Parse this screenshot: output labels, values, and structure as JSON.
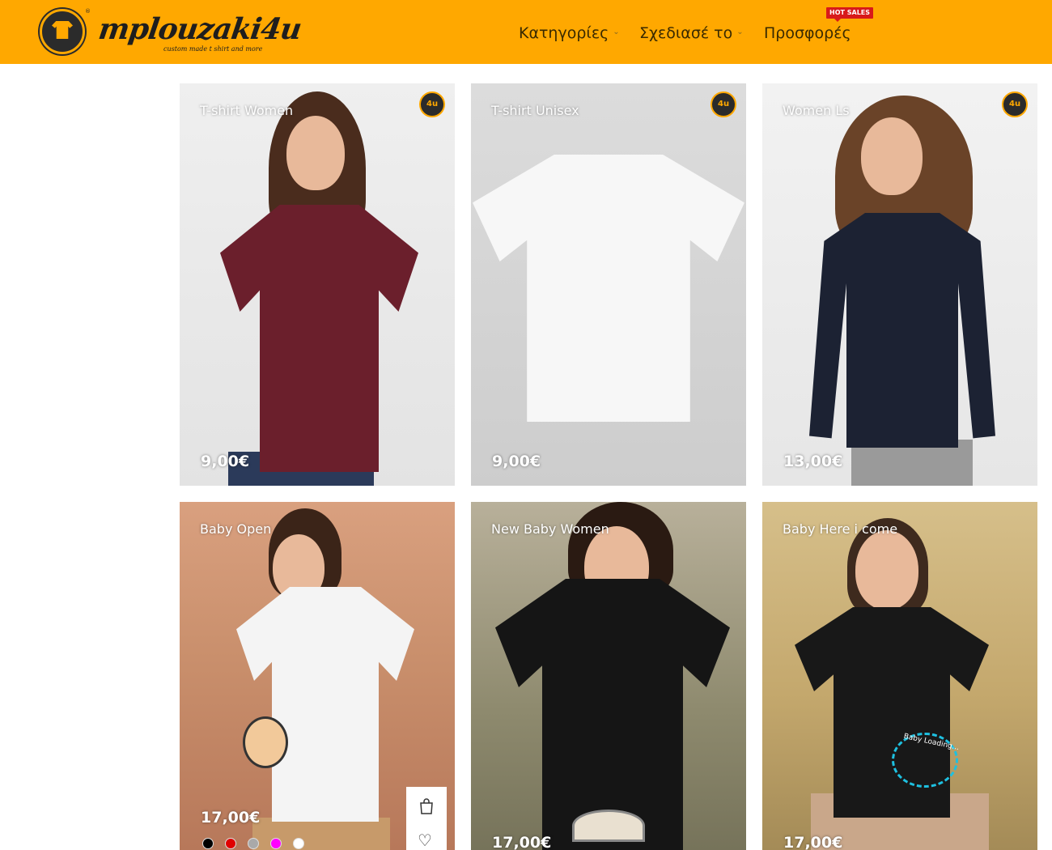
{
  "header": {
    "logo_text": "mplouzaki4u",
    "logo_tagline": "custom made t shirt and more",
    "nav": [
      {
        "label": "Κατηγορίες",
        "has_dropdown": true
      },
      {
        "label": "Σχεδιασέ το",
        "has_dropdown": true
      },
      {
        "label": "Προσφορές",
        "has_dropdown": false
      }
    ],
    "hot_badge": "HOT SALES",
    "background_color": "#ffa800"
  },
  "products": [
    {
      "title": "T-shirt Women",
      "price": "9,00€"
    },
    {
      "title": "T-shirt Unisex",
      "price": "9,00€"
    },
    {
      "title": "Women Ls",
      "price": "13,00€"
    },
    {
      "title": "Baby Open",
      "price": "17,00€",
      "swatches": [
        "#000000",
        "#e00000",
        "#a9a9a9",
        "#ff00ff",
        "#ffffff"
      ]
    },
    {
      "title": "New Baby Women",
      "price": "17,00€"
    },
    {
      "title": "Baby Here i come",
      "price": "17,00€"
    }
  ],
  "baby_loading_text": "Baby Loading..."
}
